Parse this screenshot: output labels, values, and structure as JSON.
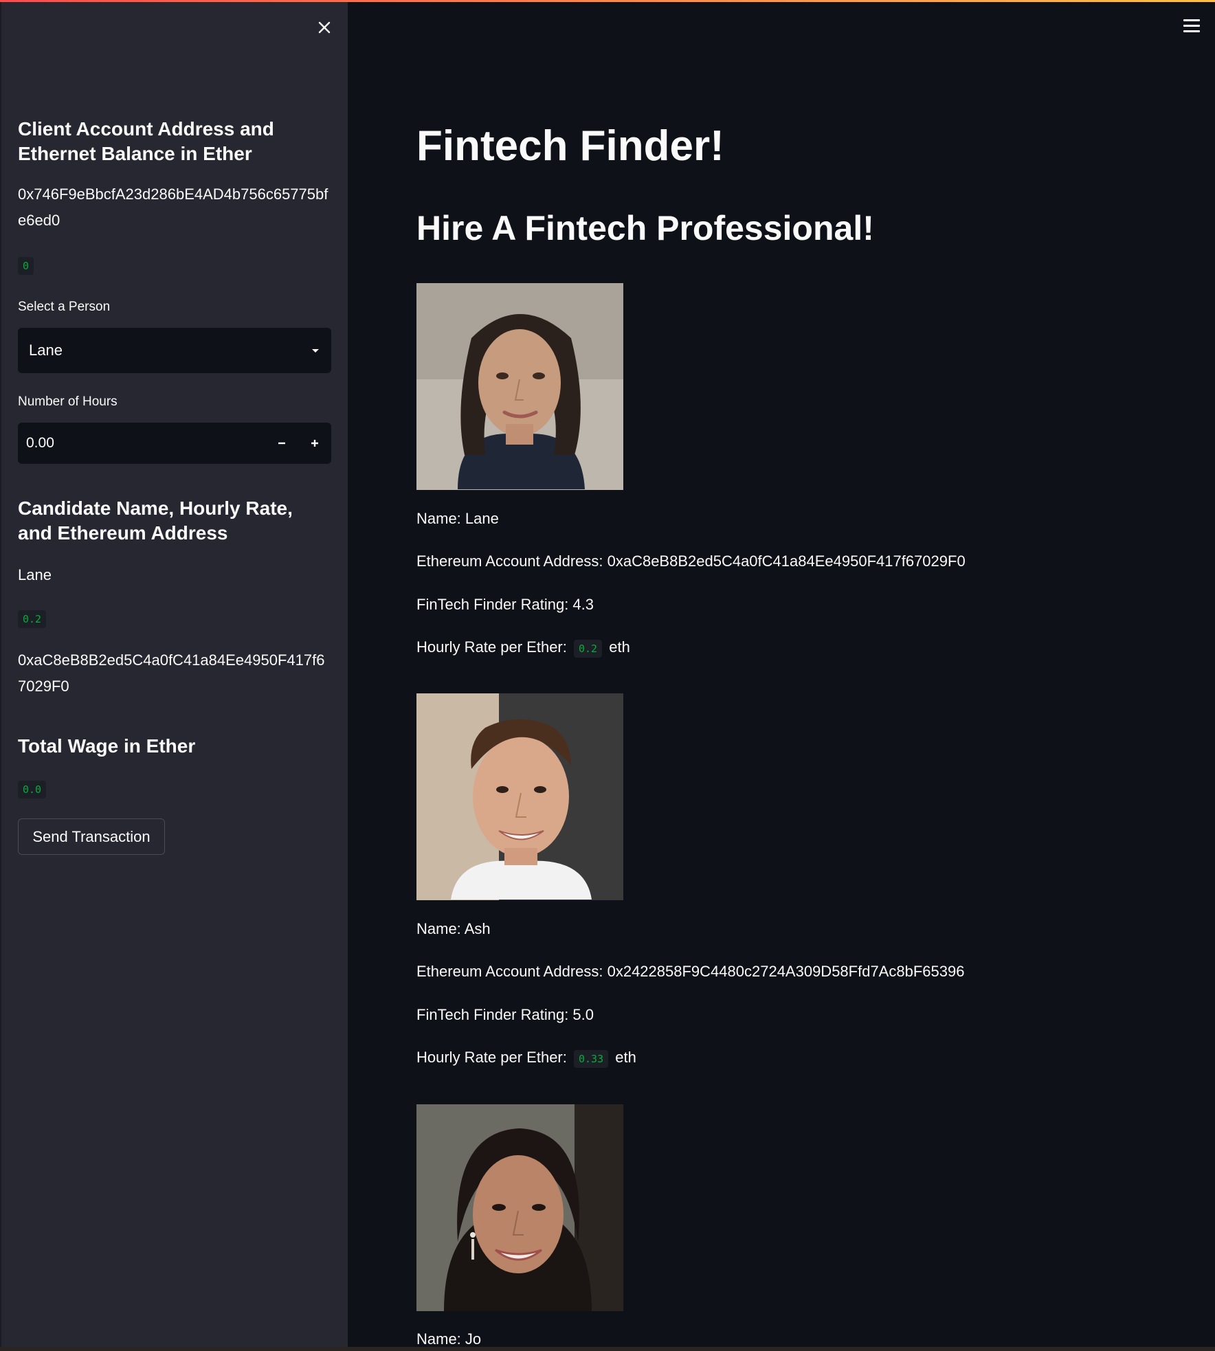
{
  "sidebar": {
    "client_heading": "Client Account Address and Ethernet Balance in Ether",
    "client_address": "0x746F9eBbcfA23d286bE4AD4b756c65775bfe6ed0",
    "client_balance": "0",
    "select_label": "Select a Person",
    "selected_person": "Lane",
    "hours_label": "Number of Hours",
    "hours_value": "0.00",
    "candidate_heading": "Candidate Name, Hourly Rate, and Ethereum Address",
    "candidate_name": "Lane",
    "candidate_rate": "0.2",
    "candidate_address": "0xaC8eB8B2ed5C4a0fC41a84Ee4950F417f67029F0",
    "wage_heading": "Total Wage in Ether",
    "wage_value": "0.0",
    "send_button": "Send Transaction"
  },
  "main": {
    "title": "Fintech Finder!",
    "subtitle": "Hire A Fintech Professional!",
    "candidates": [
      {
        "name_line": "Name: Lane",
        "address_line": "Ethereum Account Address: 0xaC8eB8B2ed5C4a0fC41a84Ee4950F417f67029F0",
        "rating_line": "FinTech Finder Rating: 4.3",
        "rate_prefix": "Hourly Rate per Ether:",
        "rate_value": "0.2",
        "rate_suffix": "eth"
      },
      {
        "name_line": "Name: Ash",
        "address_line": "Ethereum Account Address: 0x2422858F9C4480c2724A309D58Ffd7Ac8bF65396",
        "rating_line": "FinTech Finder Rating: 5.0",
        "rate_prefix": "Hourly Rate per Ether:",
        "rate_value": "0.33",
        "rate_suffix": "eth"
      },
      {
        "name_line": "Name: Jo"
      }
    ]
  },
  "icons": {
    "close": "close-icon",
    "menu": "hamburger-menu-icon",
    "dropdown": "caret-down-icon",
    "minus": "minus-icon",
    "plus": "plus-icon"
  },
  "colors": {
    "app_bg": "#0e1117",
    "sidebar_bg": "#262730",
    "code_green": "#09ab3b",
    "accent_red": "#ff4b4b"
  }
}
